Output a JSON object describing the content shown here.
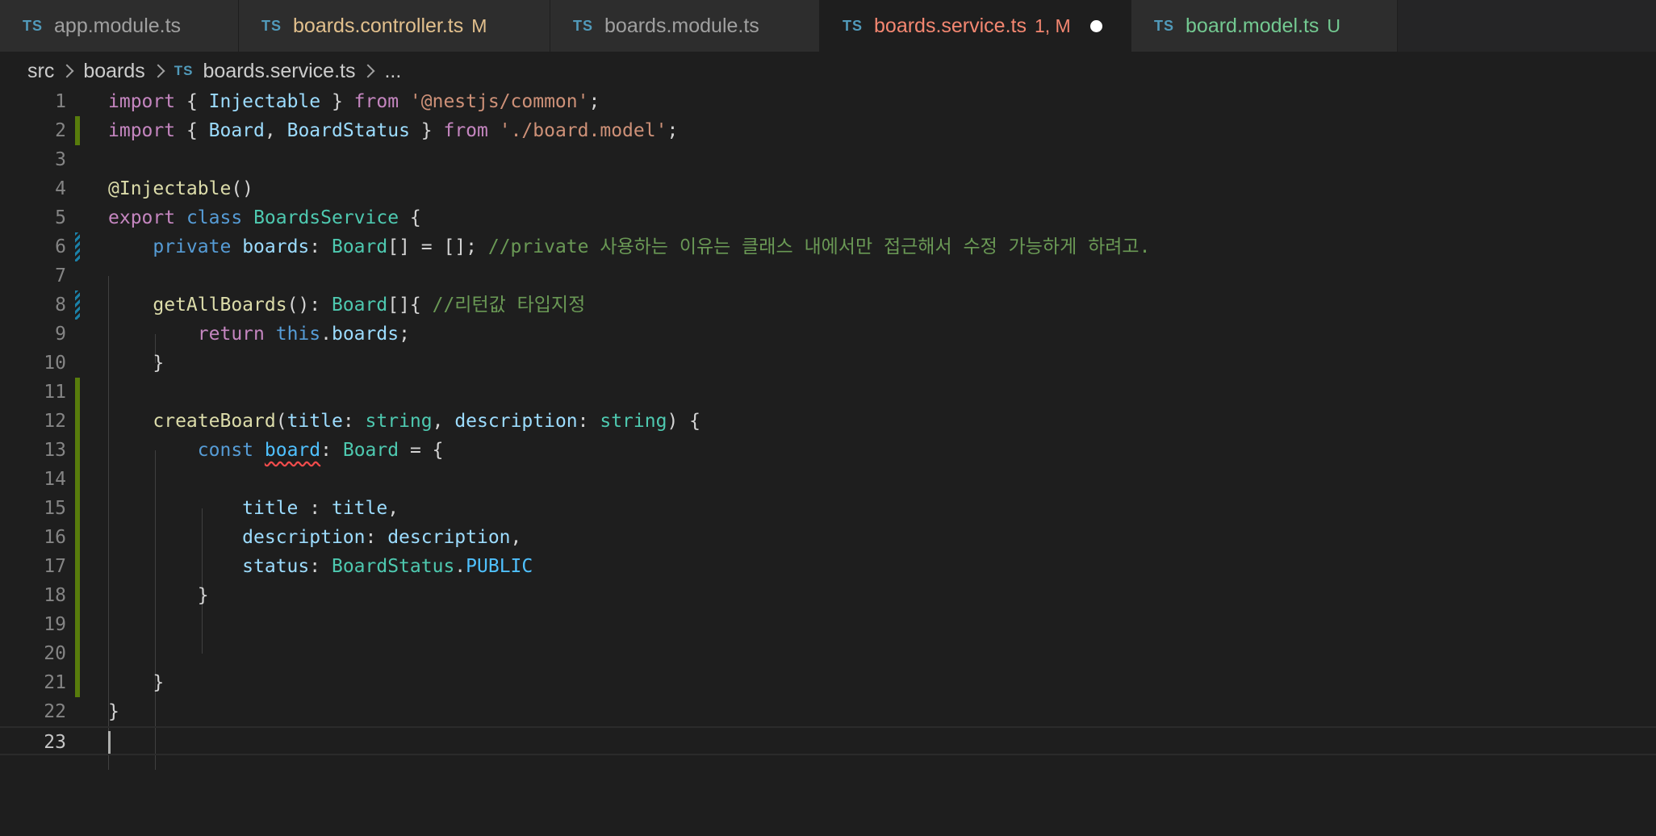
{
  "tabs": [
    {
      "ts": "TS",
      "name": "app.module.ts",
      "badge": "",
      "name_color": "#a0a0a0",
      "badge_color": ""
    },
    {
      "ts": "TS",
      "name": "boards.controller.ts",
      "badge": "M",
      "name_color": "#e2c08d",
      "badge_color": "#e2c08d"
    },
    {
      "ts": "TS",
      "name": "boards.module.ts",
      "badge": "",
      "name_color": "#a0a0a0",
      "badge_color": ""
    },
    {
      "ts": "TS",
      "name": "boards.service.ts",
      "badge": "1, M",
      "name_color": "#f48771",
      "badge_color": "#f48771"
    },
    {
      "ts": "TS",
      "name": "board.model.ts",
      "badge": "U",
      "name_color": "#73c991",
      "badge_color": "#73c991"
    }
  ],
  "breadcrumb": {
    "folder1": "src",
    "folder2": "boards",
    "ts": "TS",
    "file": "boards.service.ts",
    "more": "..."
  },
  "editor": {
    "current_line": 23,
    "lines": [
      {
        "n": "1",
        "gutter": ""
      },
      {
        "n": "2",
        "gutter": "added"
      },
      {
        "n": "3",
        "gutter": ""
      },
      {
        "n": "4",
        "gutter": ""
      },
      {
        "n": "5",
        "gutter": ""
      },
      {
        "n": "6",
        "gutter": "modified"
      },
      {
        "n": "7",
        "gutter": ""
      },
      {
        "n": "8",
        "gutter": "modified"
      },
      {
        "n": "9",
        "gutter": ""
      },
      {
        "n": "10",
        "gutter": ""
      },
      {
        "n": "11",
        "gutter": "added"
      },
      {
        "n": "12",
        "gutter": "added"
      },
      {
        "n": "13",
        "gutter": "added"
      },
      {
        "n": "14",
        "gutter": "added"
      },
      {
        "n": "15",
        "gutter": "added"
      },
      {
        "n": "16",
        "gutter": "added"
      },
      {
        "n": "17",
        "gutter": "added"
      },
      {
        "n": "18",
        "gutter": "added"
      },
      {
        "n": "19",
        "gutter": "added"
      },
      {
        "n": "20",
        "gutter": "added"
      },
      {
        "n": "21",
        "gutter": "added"
      },
      {
        "n": "22",
        "gutter": ""
      },
      {
        "n": "23",
        "gutter": ""
      }
    ],
    "code": {
      "l1": [
        [
          "kw",
          "import"
        ],
        [
          "",
          "{ "
        ],
        [
          "var",
          "Injectable"
        ],
        [
          "",
          " } "
        ],
        [
          "kw",
          "from"
        ],
        [
          "",
          " "
        ],
        [
          "str",
          "'@nestjs/common'"
        ],
        [
          "",
          ";"
        ]
      ],
      "l2": [
        [
          "kw",
          "import"
        ],
        [
          "",
          "{ "
        ],
        [
          "var",
          "Board"
        ],
        [
          "",
          ", "
        ],
        [
          "var",
          "BoardStatus"
        ],
        [
          "",
          " } "
        ],
        [
          "kw",
          "from"
        ],
        [
          "",
          " "
        ],
        [
          "str",
          "'./board.model'"
        ],
        [
          "",
          ";"
        ]
      ],
      "l3": [],
      "l4": [
        [
          "fn",
          "@Injectable"
        ],
        [
          "",
          "()"
        ]
      ],
      "l5": [
        [
          "kw",
          "export"
        ],
        [
          "",
          " "
        ],
        [
          "kw2",
          "class"
        ],
        [
          "",
          " "
        ],
        [
          "ty",
          "BoardsService"
        ],
        [
          "",
          " {"
        ]
      ],
      "l6": [
        [
          "",
          "    "
        ],
        [
          "kw2",
          "private"
        ],
        [
          "",
          " "
        ],
        [
          "var",
          "boards"
        ],
        [
          "",
          ": "
        ],
        [
          "ty",
          "Board"
        ],
        [
          "",
          "[] = []; "
        ],
        [
          "cm",
          "//private 사용하는 이유는 클래스 내에서만 접근해서 수정 가능하게 하려고."
        ]
      ],
      "l7": [],
      "l8": [
        [
          "",
          "    "
        ],
        [
          "fn",
          "getAllBoards"
        ],
        [
          "",
          "(): "
        ],
        [
          "ty",
          "Board"
        ],
        [
          "",
          "[]{ "
        ],
        [
          "cm",
          "//리턴값 타입지정"
        ]
      ],
      "l9": [
        [
          "",
          "        "
        ],
        [
          "kw",
          "return"
        ],
        [
          "",
          " "
        ],
        [
          "kw2",
          "this"
        ],
        [
          "",
          "."
        ],
        [
          "var",
          "boards"
        ],
        [
          "",
          ";"
        ]
      ],
      "l10": [
        [
          "",
          "    }"
        ]
      ],
      "l11": [],
      "l12": [
        [
          "",
          "    "
        ],
        [
          "fn",
          "createBoard"
        ],
        [
          "",
          "("
        ],
        [
          "var",
          "title"
        ],
        [
          "",
          ": "
        ],
        [
          "ty",
          "string"
        ],
        [
          "",
          ", "
        ],
        [
          "var",
          "description"
        ],
        [
          "",
          ": "
        ],
        [
          "ty",
          "string"
        ],
        [
          "",
          ") {"
        ]
      ],
      "l13": [
        [
          "",
          "        "
        ],
        [
          "kw2",
          "const"
        ],
        [
          "",
          " "
        ],
        [
          "const squig",
          "board"
        ],
        [
          "",
          ": "
        ],
        [
          "ty",
          "Board"
        ],
        [
          "",
          " = {"
        ]
      ],
      "l14": [],
      "l15": [
        [
          "",
          "            "
        ],
        [
          "var",
          "title"
        ],
        [
          "",
          " : "
        ],
        [
          "var",
          "title"
        ],
        [
          "",
          ","
        ]
      ],
      "l16": [
        [
          "",
          "            "
        ],
        [
          "var",
          "description"
        ],
        [
          "",
          ": "
        ],
        [
          "var",
          "description"
        ],
        [
          "",
          ","
        ]
      ],
      "l17": [
        [
          "",
          "            "
        ],
        [
          "var",
          "status"
        ],
        [
          "",
          ": "
        ],
        [
          "ty",
          "BoardStatus"
        ],
        [
          "",
          "."
        ],
        [
          "const",
          "PUBLIC"
        ]
      ],
      "l18": [
        [
          "",
          "        }"
        ]
      ],
      "l19": [],
      "l20": [],
      "l21": [
        [
          "",
          "    }"
        ]
      ],
      "l22": [
        [
          "",
          "}"
        ]
      ],
      "l23": []
    }
  }
}
